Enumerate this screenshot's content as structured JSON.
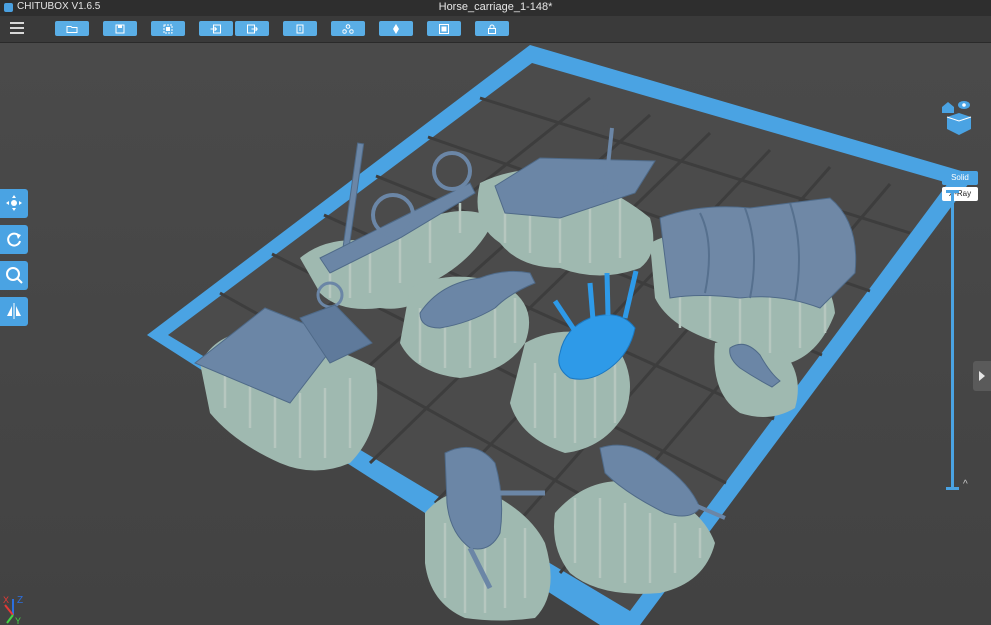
{
  "window": {
    "app_name": "CHITUBOX V1.6.5",
    "title": "Horse_carriage_1-148*"
  },
  "toolbar": {
    "buttons": [
      {
        "name": "open-file-icon"
      },
      {
        "name": "save-icon"
      },
      {
        "name": "select-all-icon"
      },
      {
        "name": "import-icon"
      },
      {
        "name": "export-icon"
      },
      {
        "name": "copy-icon"
      },
      {
        "name": "network-icon"
      },
      {
        "name": "support-icon"
      },
      {
        "name": "frame-icon"
      },
      {
        "name": "lock-icon"
      }
    ]
  },
  "side_tools": [
    {
      "name": "move-icon"
    },
    {
      "name": "rotate-icon"
    },
    {
      "name": "scale-icon"
    },
    {
      "name": "mirror-icon"
    }
  ],
  "render_mode": {
    "solid_label": "Solid",
    "xray_label": "X-Ray",
    "selected": "Solid"
  },
  "layer_slider": {
    "up_label": "^",
    "down_label": "⌄"
  },
  "axes": {
    "x": "X",
    "y": "Y",
    "z": "Z",
    "colors": {
      "x": "#e53935",
      "y": "#43d643",
      "z": "#2b6fe0"
    }
  },
  "colors": {
    "accent": "#4aa3e3",
    "plate_border": "#4aa3e3",
    "model": "#6b86a6",
    "model_selected": "#2e9ae8",
    "raft": "#9fb9b0"
  }
}
